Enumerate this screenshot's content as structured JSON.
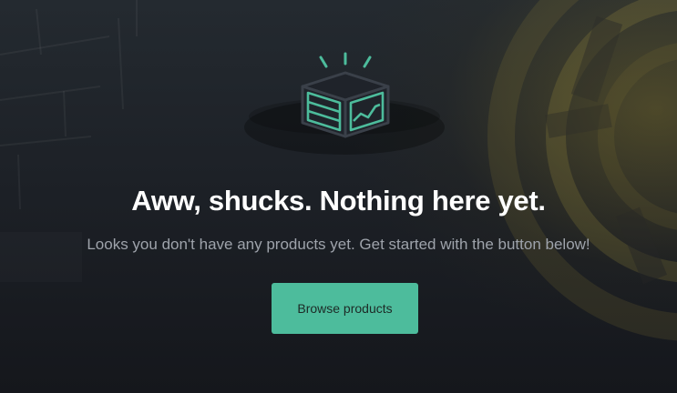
{
  "empty_state": {
    "title": "Aww, shucks. Nothing here yet.",
    "subtitle": "Looks you don't have any products yet. Get started with the button below!",
    "cta_label": "Browse products",
    "illustration_icon": "open-box-icon"
  },
  "colors": {
    "accent": "#4dbc9c",
    "title": "#ffffff",
    "subtitle": "#9ea3ab",
    "background": "#15171c"
  }
}
